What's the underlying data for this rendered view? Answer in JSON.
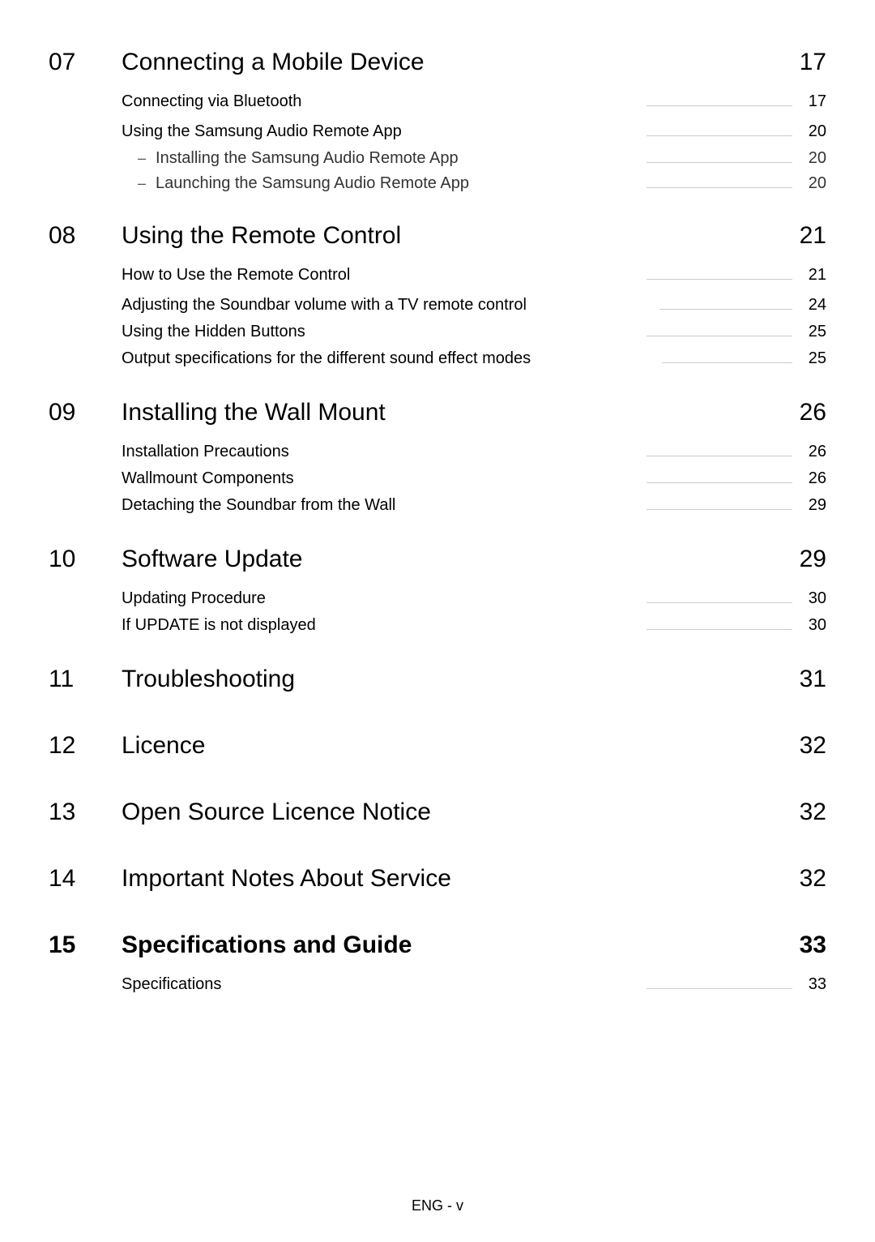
{
  "sections": [
    {
      "number": "07",
      "title": "Connecting a Mobile Device",
      "page": "17",
      "bold": false,
      "entries": [
        {
          "title": "Connecting via Bluetooth",
          "page": "17",
          "sub": []
        },
        {
          "title": "Using the Samsung Audio Remote App",
          "page": "20",
          "gap": true,
          "sub": [
            {
              "title": "Installing the Samsung Audio Remote App",
              "page": "20"
            },
            {
              "title": "Launching the Samsung Audio Remote App",
              "page": "20"
            }
          ]
        }
      ]
    },
    {
      "number": "08",
      "title": "Using the Remote Control",
      "page": "21",
      "bold": false,
      "entries": [
        {
          "title": "How to Use the Remote Control",
          "page": "21",
          "sub": []
        },
        {
          "title": "Adjusting the Soundbar volume with a TV remote control",
          "page": "24",
          "gap": true,
          "sub": []
        },
        {
          "title": "Using the Hidden Buttons",
          "page": "25",
          "sub": []
        },
        {
          "title": "Output specifications for the different sound effect modes",
          "page": "25",
          "sub": []
        }
      ]
    },
    {
      "number": "09",
      "title": "Installing the Wall Mount",
      "page": "26",
      "bold": false,
      "entries": [
        {
          "title": "Installation Precautions",
          "page": "26",
          "sub": []
        },
        {
          "title": "Wallmount Components",
          "page": "26",
          "sub": []
        },
        {
          "title": "Detaching the Soundbar from the Wall",
          "page": "29",
          "sub": []
        }
      ]
    },
    {
      "number": "10",
      "title": "Software Update",
      "page": "29",
      "bold": false,
      "entries": [
        {
          "title": "Updating Procedure",
          "page": "30",
          "sub": []
        },
        {
          "title": "If UPDATE is not displayed",
          "page": "30",
          "sub": []
        }
      ]
    },
    {
      "number": "11",
      "title": "Troubleshooting",
      "page": "31",
      "bold": false,
      "entries": []
    },
    {
      "number": "12",
      "title": "Licence",
      "page": "32",
      "bold": false,
      "entries": []
    },
    {
      "number": "13",
      "title": "Open Source Licence Notice",
      "page": "32",
      "bold": false,
      "entries": []
    },
    {
      "number": "14",
      "title": "Important Notes About Service",
      "page": "32",
      "bold": false,
      "entries": []
    },
    {
      "number": "15",
      "title": "Specifications and Guide",
      "page": "33",
      "bold": true,
      "entries": [
        {
          "title": "Specifications",
          "page": "33",
          "sub": []
        }
      ]
    }
  ],
  "footer": "ENG - v"
}
